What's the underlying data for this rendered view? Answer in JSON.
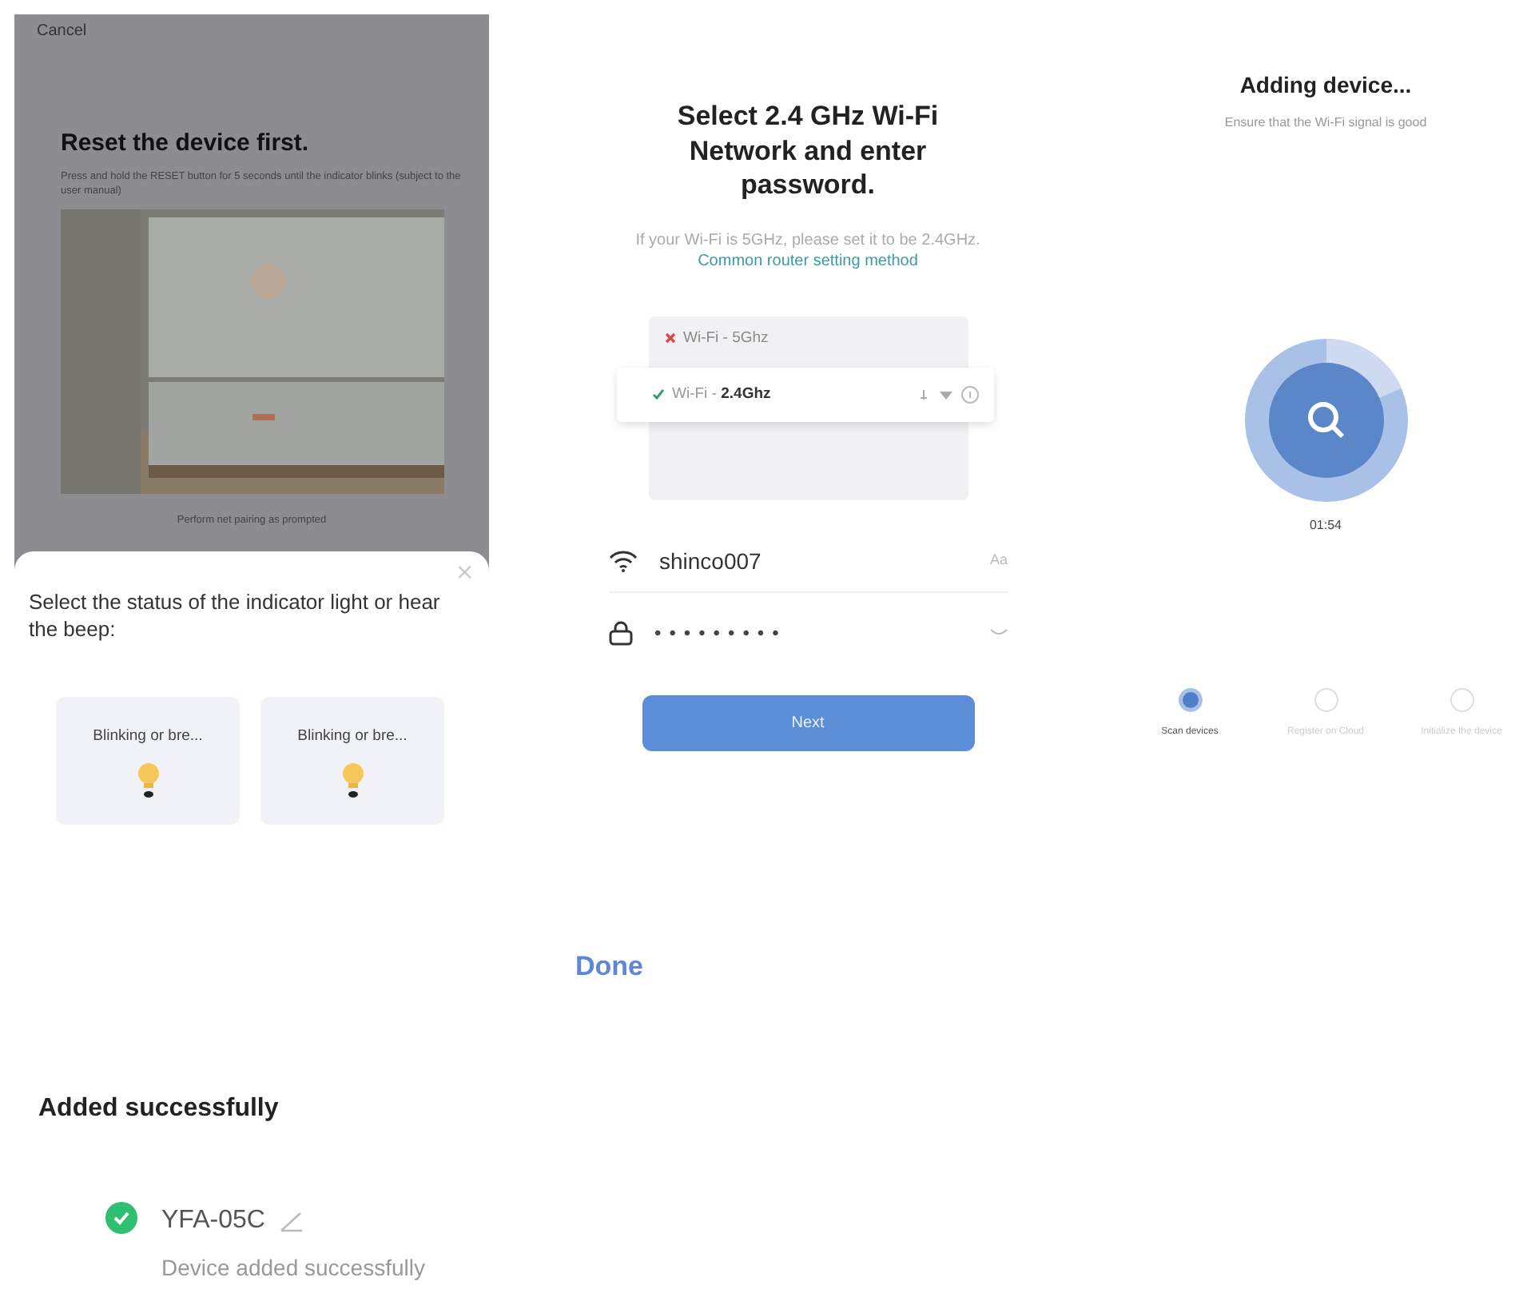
{
  "reset_screen": {
    "cancel": "Cancel",
    "title": "Reset the device first.",
    "description": "Press and hold the RESET button for 5 seconds until the indicator blinks (subject to the user manual)",
    "caption": "Perform net pairing as prompted",
    "sheet": {
      "close": "×",
      "prompt": "Select the status of the indicator light or hear the beep:",
      "options": [
        {
          "label": "Blinking or bre..."
        },
        {
          "label": "Blinking or bre..."
        }
      ]
    }
  },
  "wifi_screen": {
    "title": "Select 2.4 GHz Wi-Fi Network and enter password.",
    "hint": "If your Wi-Fi is 5GHz, please set it to be 2.4GHz.",
    "hint_link": "Common router setting method",
    "networks": [
      {
        "label": "Wi-Fi - 5Ghz",
        "kind": "rejected"
      },
      {
        "label": "Wi-Fi - **2.4Ghz**",
        "kind": "accepted"
      }
    ],
    "ssid": "shinco007",
    "ssid_action": "Aa",
    "password": "•••••••••",
    "next": "Next"
  },
  "adding_screen": {
    "title": "Adding device...",
    "subtitle": "Ensure that the Wi-Fi signal is good",
    "timer": "01:54",
    "steps": [
      {
        "label": "Scan devices",
        "selected": true
      },
      {
        "label": "Register on Cloud",
        "selected": false
      },
      {
        "label": "Initialize the device",
        "selected": false
      }
    ]
  },
  "success_screen": {
    "done": "Done",
    "title": "Added successfully",
    "device_name": "YFA-05C",
    "status": "Device added successfully"
  }
}
